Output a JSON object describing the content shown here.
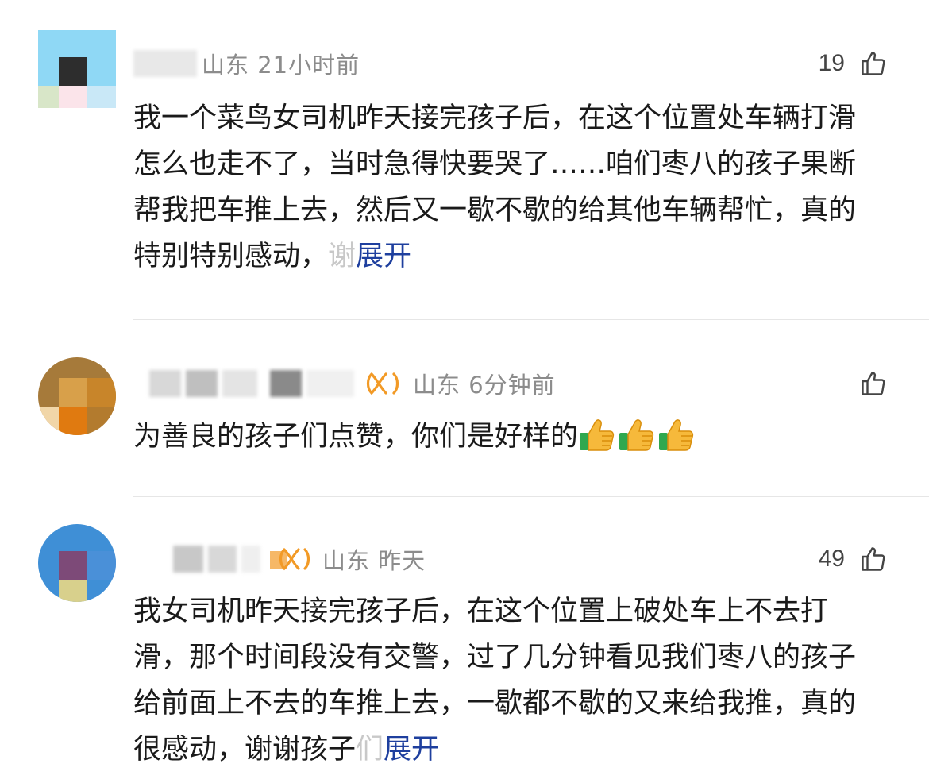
{
  "comments": [
    {
      "location_time": "山东 21小时前",
      "likes": "19",
      "text_prefix": "我一个菜鸟女司机昨天接完孩子后，在这个位置处车辆打滑怎么也走不了，当时急得快要哭了……咱们枣八的孩子果断帮我把车推上去，然后又一歇不歇的给其他车辆帮忙，真的特别特别感动，",
      "text_fade": "谢",
      "expand_label": "展开"
    },
    {
      "location_time": "山东 6分钟前",
      "likes": "",
      "text": "为善良的孩子们点赞，你们是好样的",
      "emoji": [
        "thumbs-up-icon",
        "thumbs-up-icon",
        "thumbs-up-icon"
      ]
    },
    {
      "location_time": "山东 昨天",
      "likes": "49",
      "text_prefix": "我女司机昨天接完孩子后，在这个位置上破处车上不去打滑，那个时间段没有交警，过了几分钟看见我们枣八的孩子给前面上不去的车推上去，一歇都不歇的又来给我推，真的很感动，谢谢孩子",
      "text_fade": "们",
      "expand_label": "展开"
    }
  ],
  "colors": {
    "expand": "#1e3f9e",
    "meta": "#8c8c8c",
    "badge": "#f29a26"
  }
}
